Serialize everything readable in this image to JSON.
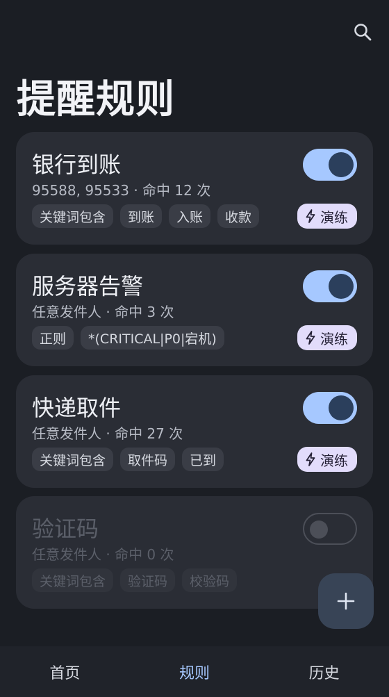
{
  "page": {
    "title": "提醒规则"
  },
  "colors": {
    "accent": "#a6c8ff",
    "practice_bg": "#e2dcfb",
    "card_bg": "#2a2d35",
    "app_bg": "#1b1e24"
  },
  "rules": [
    {
      "name": "银行到账",
      "meta": "95588, 95533 · 命中 12 次",
      "enabled": true,
      "chips": [
        "关键词包含",
        "到账",
        "入账",
        "收款"
      ],
      "practice_label": "演练"
    },
    {
      "name": "服务器告警",
      "meta": "任意发件人 · 命中 3 次",
      "enabled": true,
      "chips": [
        "正则",
        "*(CRITICAL|P0|宕机)"
      ],
      "practice_label": "演练"
    },
    {
      "name": "快递取件",
      "meta": "任意发件人 · 命中 27 次",
      "enabled": true,
      "chips": [
        "关键词包含",
        "取件码",
        "已到"
      ],
      "practice_label": "演练"
    },
    {
      "name": "验证码",
      "meta": "任意发件人 · 命中 0 次",
      "enabled": false,
      "chips": [
        "关键词包含",
        "验证码",
        "校验码"
      ]
    }
  ],
  "icons": {
    "search": "search-icon",
    "practice": "bolt-icon",
    "add": "plus-icon"
  },
  "nav": {
    "items": [
      {
        "label": "首页",
        "active": false
      },
      {
        "label": "规则",
        "active": true
      },
      {
        "label": "历史",
        "active": false
      }
    ]
  }
}
